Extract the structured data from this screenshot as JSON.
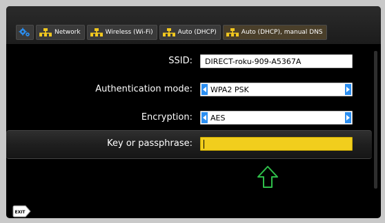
{
  "breadcrumbs": [
    {
      "label": "Network",
      "icon": "network-icon"
    },
    {
      "label": "Wireless (Wi-Fi)",
      "icon": "network-icon"
    },
    {
      "label": "Auto (DHCP)",
      "icon": "network-icon"
    },
    {
      "label": "Auto (DHCP), manual DNS",
      "icon": "network-icon"
    }
  ],
  "form": {
    "ssid": {
      "label": "SSID:",
      "value": "DIRECT-roku-909-A5367A"
    },
    "auth_mode": {
      "label": "Authentication mode:",
      "value": "WPA2 PSK"
    },
    "encryption": {
      "label": "Encryption:",
      "value": "AES"
    },
    "passphrase": {
      "label": "Key or passphrase:",
      "value": ""
    }
  },
  "exit_button": {
    "label": "EXIT"
  },
  "colors": {
    "focus_field": "#f1ce1d",
    "selector_arrow": "#2b8ff2",
    "pointer_arrow": "#2fbf4a",
    "icon_yellow": "#f2c81e"
  }
}
